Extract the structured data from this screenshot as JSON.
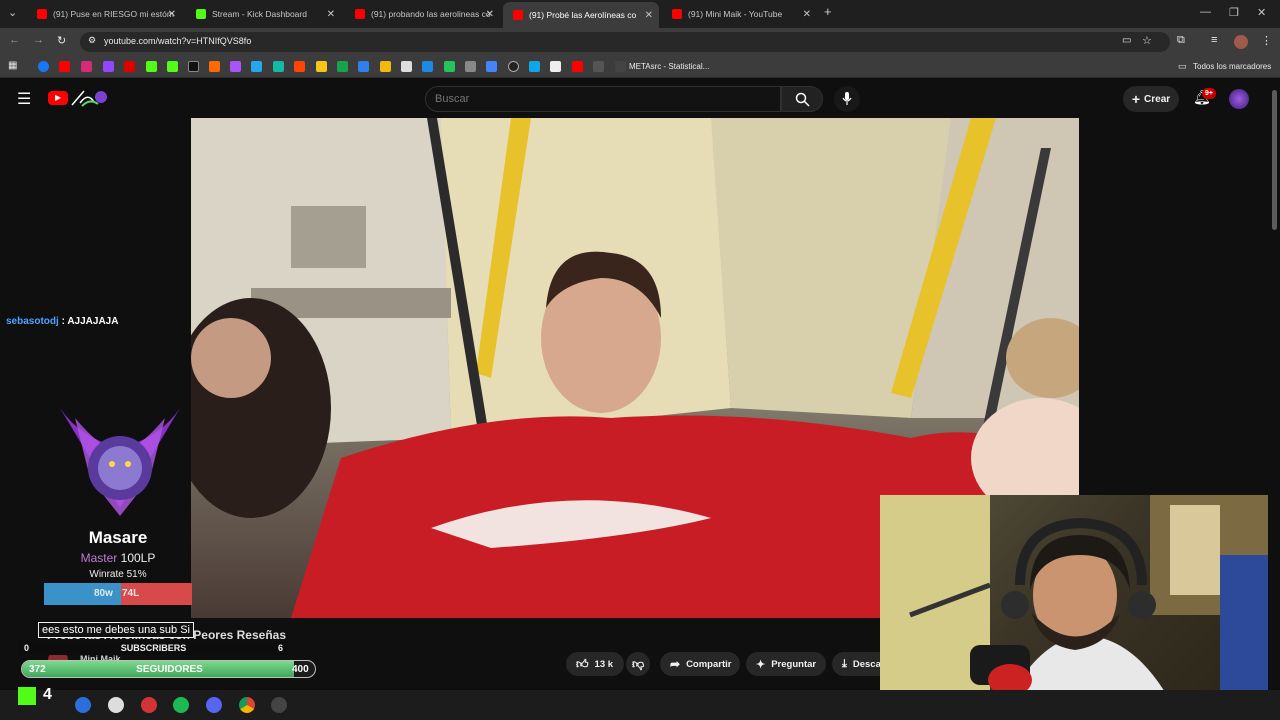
{
  "browser": {
    "tabs": [
      {
        "label": "(91) Puse en RIESGO mi estóm",
        "color": "#ff0000"
      },
      {
        "label": "Stream - Kick Dashboard",
        "color": "#53fc18"
      },
      {
        "label": "(91) probando las aerolineas co",
        "color": "#ff0000"
      },
      {
        "label": "(91) Probé las Aerolíneas co",
        "color": "#ff0000"
      },
      {
        "label": "(91) Mini Maik - YouTube",
        "color": "#ff0000"
      }
    ],
    "url": "youtube.com/watch?v=HTNIfQVS8fo",
    "bookmark_metasrc": "METAsrc - Statistical...",
    "bookmark_all": "Todos los marcadores"
  },
  "youtube": {
    "search_placeholder": "Buscar",
    "create_label": "Crear",
    "notification_badge": "9+",
    "video_title": "Probé las Aerolíneas con Peores Reseñas",
    "likes": "13 k",
    "share_label": "Compartir",
    "ask_label": "Preguntar",
    "download_label": "Desca",
    "channel_name": "Mini Maik"
  },
  "overlay": {
    "chat_user": "sebasotodj",
    "chat_text": ": AJJAJAJA",
    "rank_name": "Masare",
    "rank_tier": "Master",
    "rank_lp": "100LP",
    "winrate": "Winrate 51%",
    "wins": "80w",
    "losses": "74L",
    "win_fraction": 0.52,
    "caption": "ees esto me debes una sub Si",
    "subs_left": "0",
    "subs_label": "SUBSCRIBERS",
    "subs_right": "6",
    "followers_current": "372",
    "followers_label": "SEGUIDORES",
    "followers_goal": "400",
    "followers_fraction": 0.93,
    "taskbar_number": "4"
  },
  "colors": {
    "kick_green": "#53fc18",
    "yt_red": "#ff0000",
    "chat_user": "#4fa3ff",
    "tier_purple": "#c07ad8"
  }
}
